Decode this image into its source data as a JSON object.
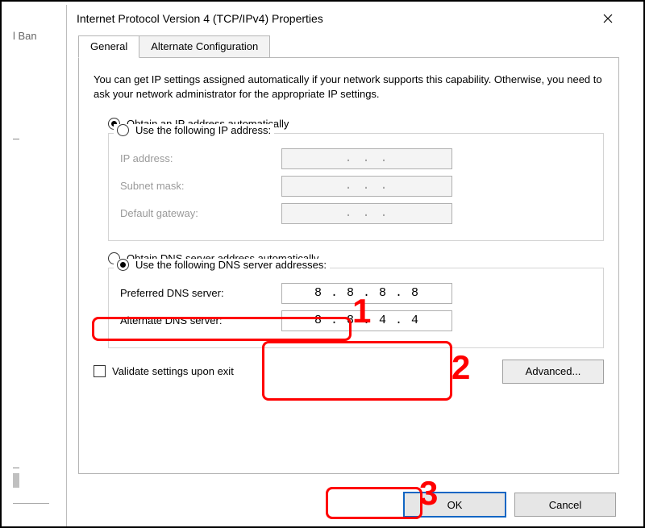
{
  "bg": {
    "sidebar_fragment": "l Ban"
  },
  "dialog": {
    "title": "Internet Protocol Version 4 (TCP/IPv4) Properties",
    "tabs": {
      "general": "General",
      "alternate": "Alternate Configuration"
    },
    "description": "You can get IP settings assigned automatically if your network supports this capability. Otherwise, you need to ask your network administrator for the appropriate IP settings.",
    "ip": {
      "obtain_auto": "Obtain an IP address automatically",
      "use_following": "Use the following IP address:",
      "selected": "auto",
      "address_label": "IP address:",
      "subnet_label": "Subnet mask:",
      "gateway_label": "Default gateway:",
      "placeholder": ".       .       ."
    },
    "dns": {
      "obtain_auto": "Obtain DNS server address automatically",
      "use_following": "Use the following DNS server addresses:",
      "selected": "manual",
      "preferred_label": "Preferred DNS server:",
      "alternate_label": "Alternate DNS server:",
      "preferred_value": "8 . 8 . 8 . 8",
      "alternate_value": "8 . 8 . 4 . 4"
    },
    "validate_label": "Validate settings upon exit",
    "validate_checked": false,
    "advanced_label": "Advanced...",
    "ok_label": "OK",
    "cancel_label": "Cancel"
  },
  "callouts": {
    "one": "1",
    "two": "2",
    "three": "3"
  }
}
